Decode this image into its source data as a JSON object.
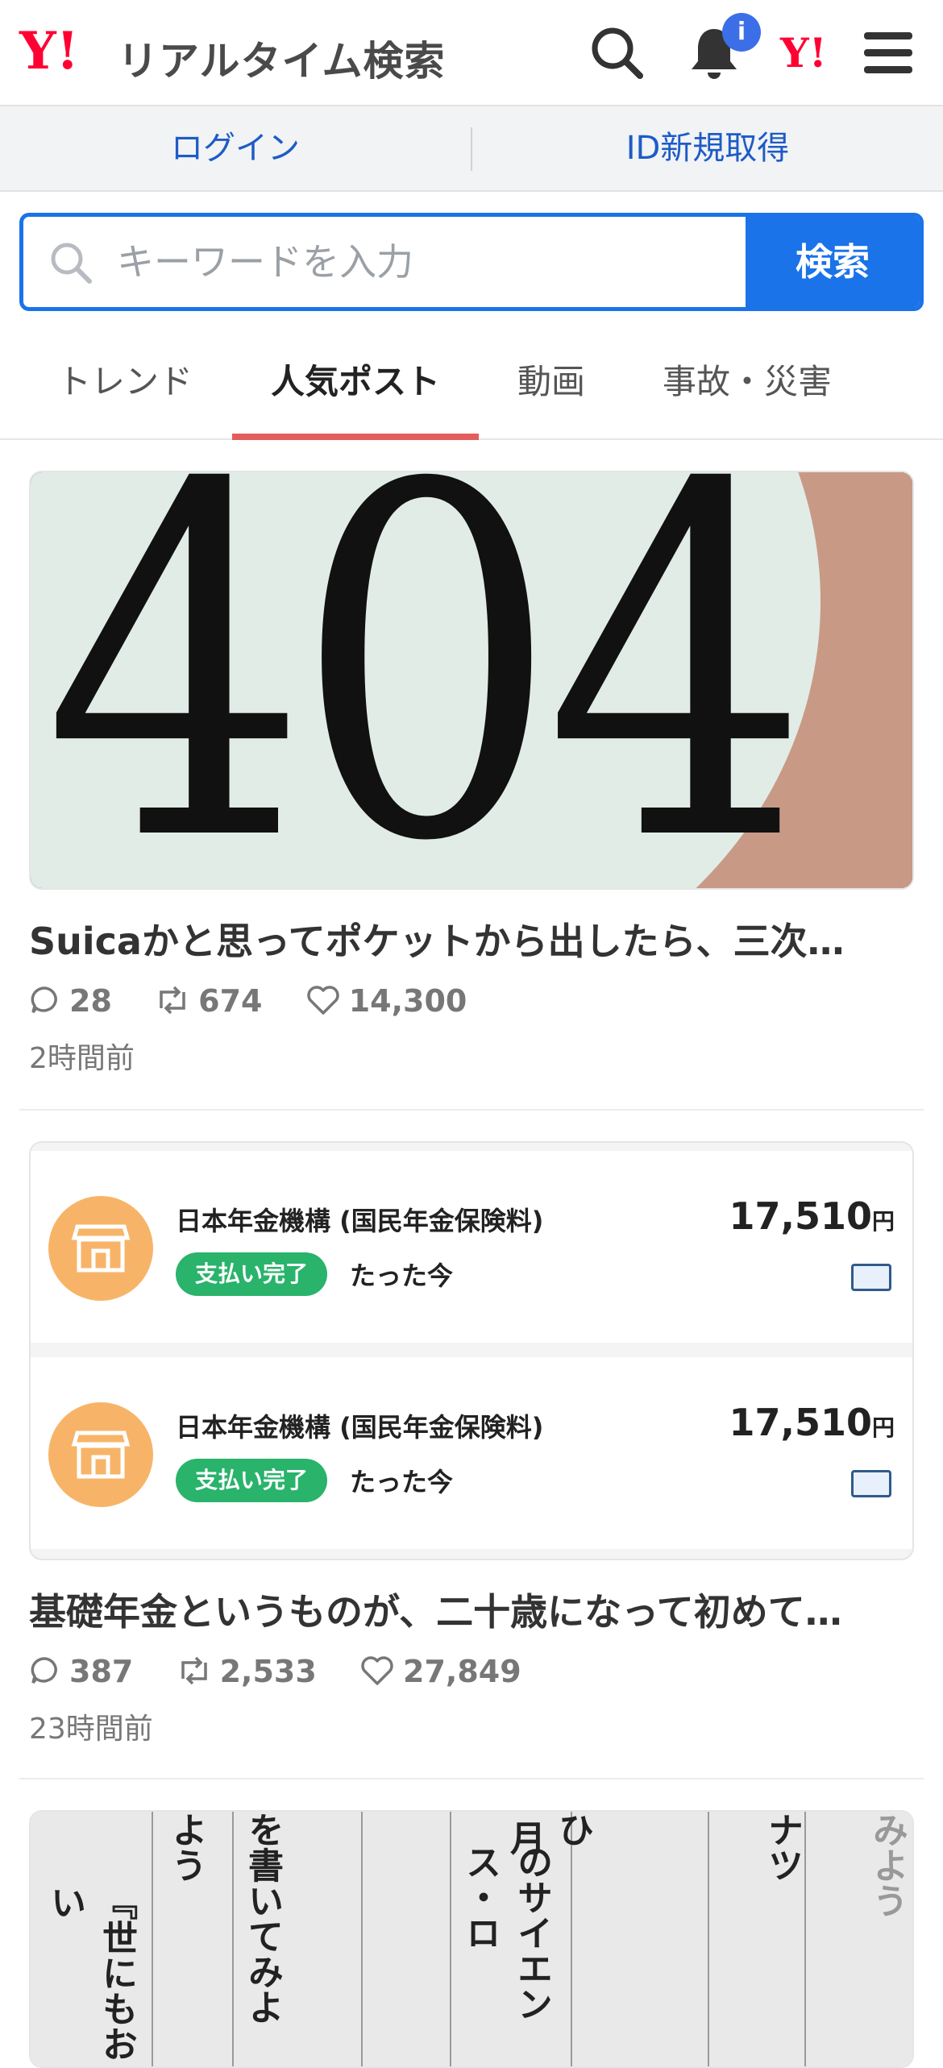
{
  "header": {
    "logo_mark": "Y!",
    "logo_text": "リアルタイム検索",
    "notification_badge": "i",
    "yahoo_mark": "Y!"
  },
  "account_bar": {
    "login": "ログイン",
    "register": "ID新規取得"
  },
  "search": {
    "placeholder": "キーワードを入力",
    "button": "検索"
  },
  "tabs": [
    {
      "label": "トレンド",
      "active": false
    },
    {
      "label": "人気ポスト",
      "active": true
    },
    {
      "label": "動画",
      "active": false
    },
    {
      "label": "事故・災害",
      "active": false
    }
  ],
  "posts": [
    {
      "image_text": "404",
      "title": "Suicaかと思ってポケットから出したら、三次…",
      "replies": "28",
      "reposts": "674",
      "likes": "14,300",
      "time": "2時間前"
    },
    {
      "payments": [
        {
          "name": "日本年金機構 (国民年金保険料)",
          "status": "支払い完了",
          "when": "たった今",
          "amount": "17,510",
          "currency": "円"
        },
        {
          "name": "日本年金機構 (国民年金保険料)",
          "status": "支払い完了",
          "when": "たった今",
          "amount": "17,510",
          "currency": "円"
        }
      ],
      "title": "基礎年金というものが、二十歳になって初めて…",
      "replies": "387",
      "reposts": "2,533",
      "likes": "27,849",
      "time": "23時間前"
    },
    {
      "image_text": {
        "line1": "『世にもおい",
        "line2": "よう",
        "line3": "を書いてみよ",
        "line4": "のサイエンス・ロ",
        "line5": "月",
        "line6": "ひ",
        "line7": "ナツ",
        "line8": "みよう"
      }
    }
  ],
  "colors": {
    "brand_red": "#ff0033",
    "link_blue": "#1e5bc6",
    "search_blue": "#1a73e8",
    "tab_underline": "#e35d5d",
    "paid_green": "#29b36b"
  }
}
